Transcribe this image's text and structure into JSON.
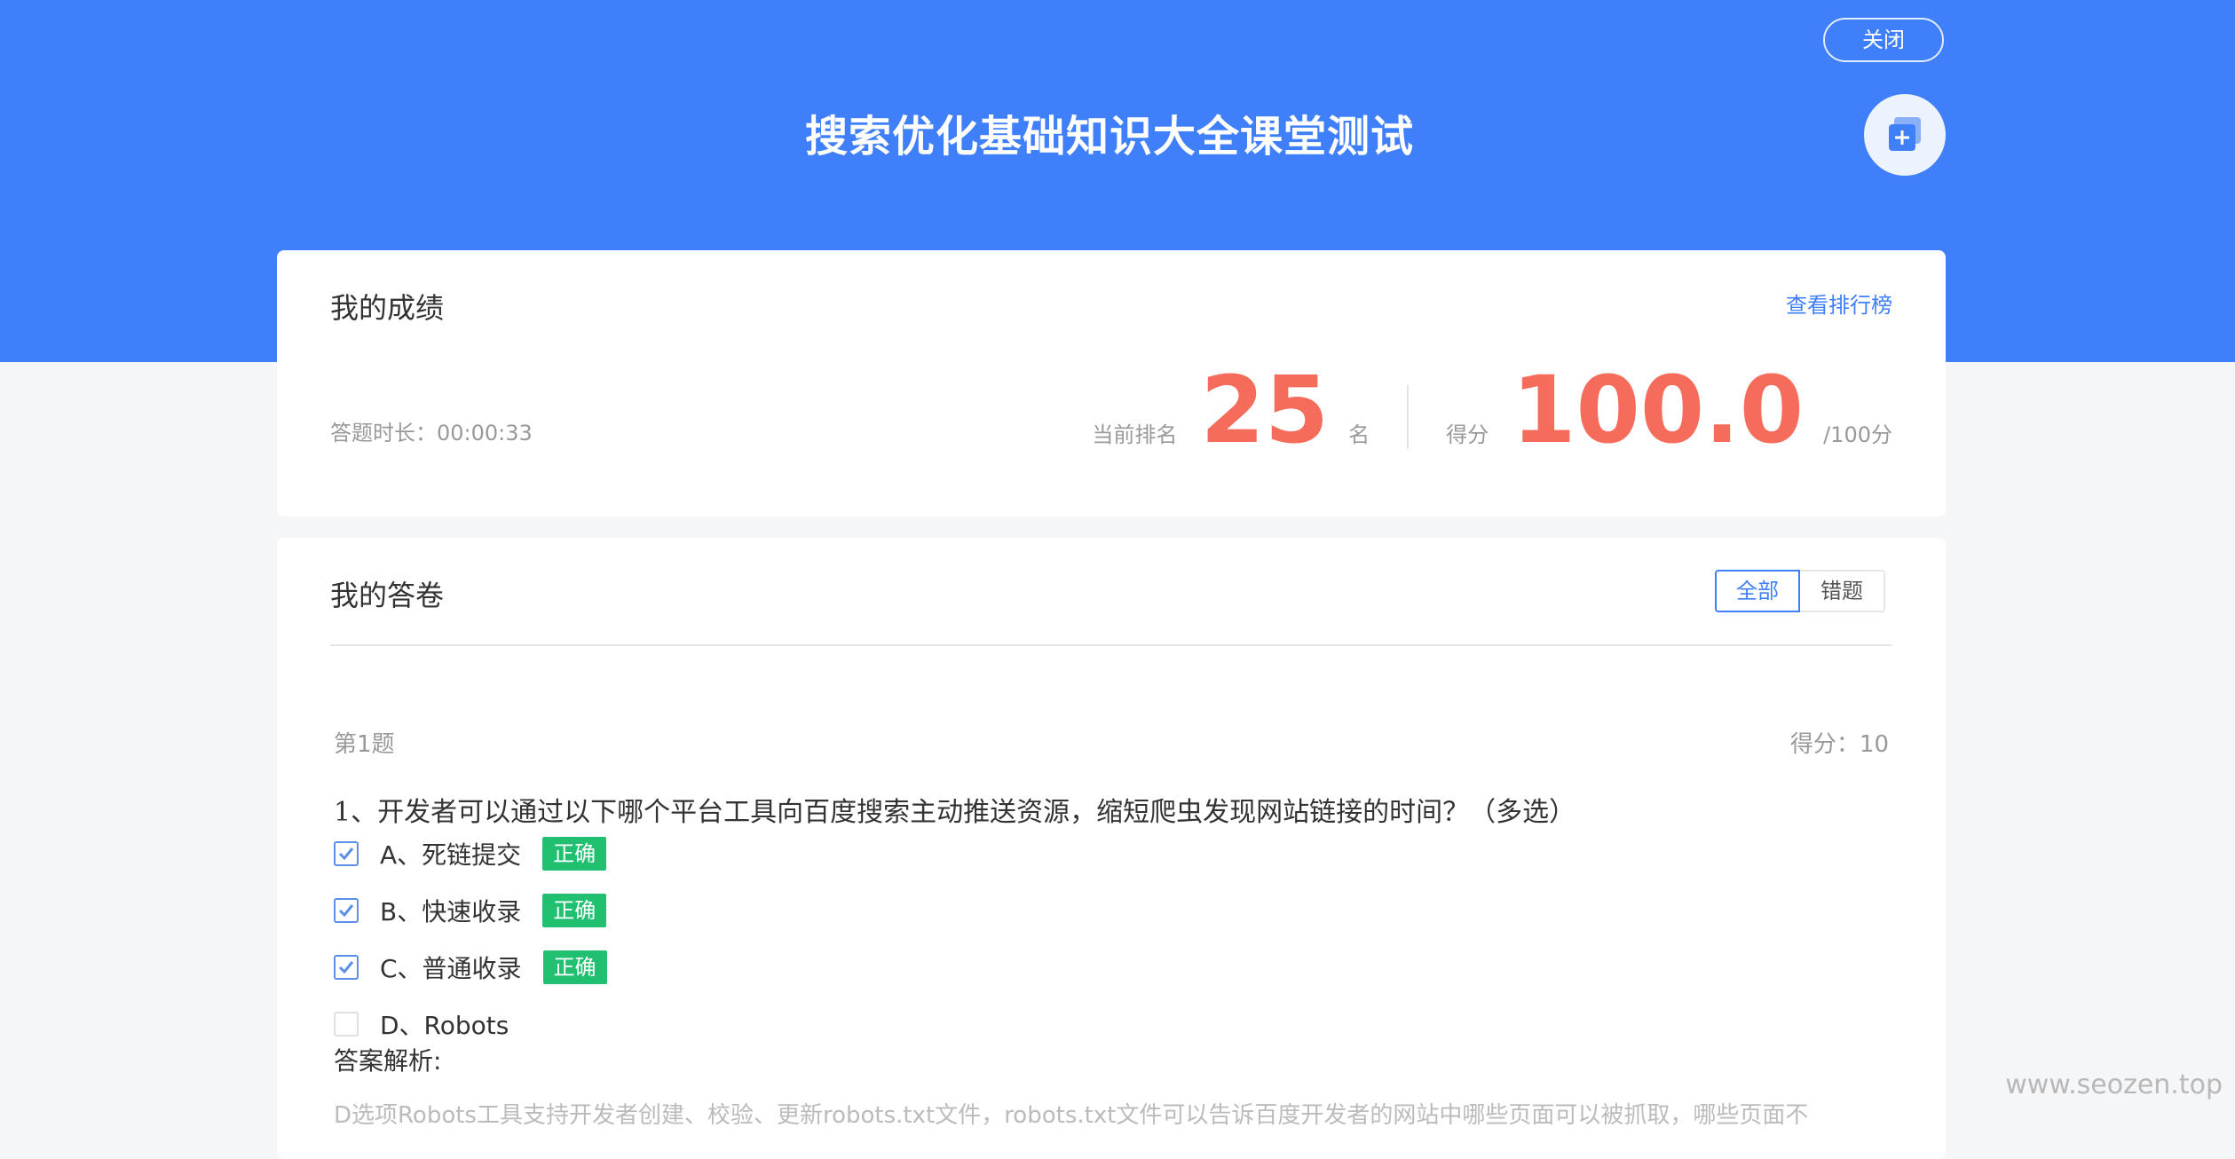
{
  "header": {
    "close_label": "关闭",
    "title": "搜索优化基础知识大全课堂测试",
    "fab_icon": "copy-add-icon",
    "background_color": "#3f80fa"
  },
  "score_card": {
    "title": "我的成绩",
    "leaderboard_link": "查看排行榜",
    "duration_label": "答题时长：",
    "duration_value": "00:00:33",
    "rank_label": "当前排名",
    "rank_value": "25",
    "rank_unit": "名",
    "score_label": "得分",
    "score_value": "100.0",
    "score_total": "/100分",
    "accent_color": "#f56c5b"
  },
  "answers_card": {
    "title": "我的答卷",
    "filters": [
      {
        "label": "全部",
        "active": true
      },
      {
        "label": "错题",
        "active": false
      }
    ],
    "question": {
      "number_label": "第1题",
      "score_label": "得分：10",
      "text": "1、开发者可以通过以下哪个平台工具向百度搜索主动推送资源，缩短爬虫发现网站链接的时间？（多选）",
      "options": [
        {
          "label": "A、死链提交",
          "checked": true,
          "badge": "正确"
        },
        {
          "label": "B、快速收录",
          "checked": true,
          "badge": "正确"
        },
        {
          "label": "C、普通收录",
          "checked": true,
          "badge": "正确"
        },
        {
          "label": "D、Robots",
          "checked": false,
          "badge": ""
        }
      ],
      "analysis_title": "答案解析:",
      "analysis_text": "D选项Robots工具支持开发者创建、校验、更新robots.txt文件，robots.txt文件可以告诉百度开发者的网站中哪些页面可以被抓取，哪些页面不"
    },
    "badge_color": "#20c070"
  },
  "watermark": "www.seozen.top"
}
